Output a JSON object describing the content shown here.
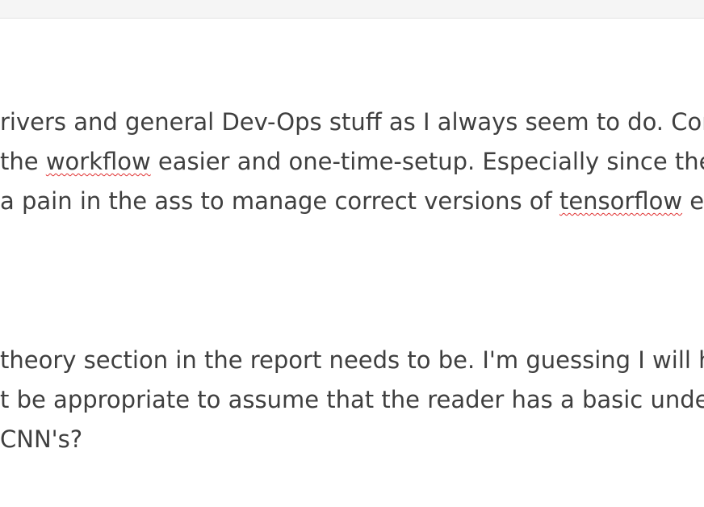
{
  "document": {
    "paragraph1": {
      "line1": {
        "text": "rivers and general Dev-Ops stuff as I always seem to do. Cons"
      },
      "line2": {
        "before": " the ",
        "flagged": "workflow",
        "after": " easier and one-time-setup. Especially since the"
      },
      "line3": {
        "before": "a pain in the ass to manage correct versions of ",
        "flagged": "tensorflow",
        "after": " et"
      }
    },
    "paragraph2": {
      "line1": {
        "text": " theory section in the report needs to be. I'm guessing I will h"
      },
      "line2": {
        "text": "t be appropriate to assume that the reader has a basic unde"
      },
      "line3": {
        "text": " CNN's?"
      }
    }
  },
  "colors": {
    "text": "#3f3f3f",
    "spellcheck_underline": "#e03030",
    "toolbar_background": "#f5f5f5"
  }
}
